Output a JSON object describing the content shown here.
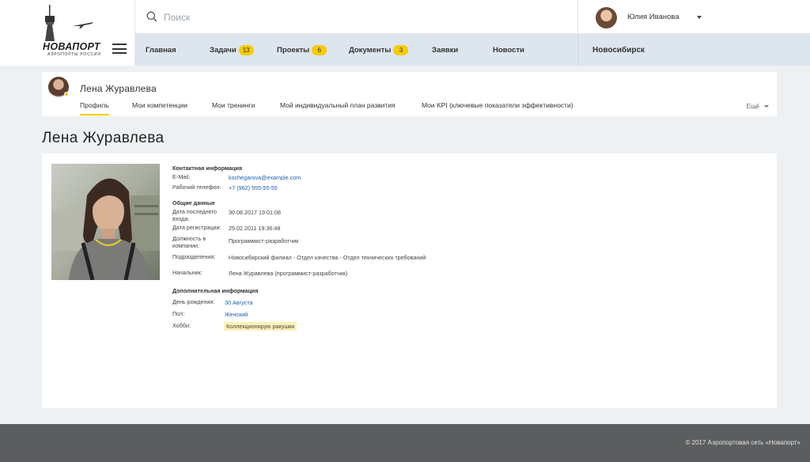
{
  "header": {
    "logo": {
      "name": "НОВАПОРТ",
      "tagline": "АЭРОПОРТЫ РОССИИ"
    },
    "search": {
      "placeholder": "Поиск",
      "value": ""
    },
    "user": {
      "name": "Юлия Иванова"
    }
  },
  "nav": {
    "items": [
      {
        "label": "Главная"
      },
      {
        "label": "Задачи",
        "badge": "13"
      },
      {
        "label": "Проекты",
        "badge": "6"
      },
      {
        "label": "Документы",
        "badge": "3"
      },
      {
        "label": "Заявки"
      },
      {
        "label": "Новости"
      }
    ],
    "city": "Новосибирск"
  },
  "profile_header": {
    "name": "Лена Журавлева",
    "tabs": [
      {
        "label": "Профиль",
        "active": true
      },
      {
        "label": "Мои компетенции"
      },
      {
        "label": "Мои тренинги"
      },
      {
        "label": "Мой индивидуальный план развития"
      },
      {
        "label": "Мои KPI (ключевые показатели эффективности)"
      }
    ],
    "more": "Ещё"
  },
  "page_title": "Лена Журавлева",
  "profile": {
    "contact": {
      "title": "Контактная информация",
      "email_label": "E-Mail:",
      "email": "kochegarova@example.com",
      "phone_label": "Рабочий телефон:",
      "phone": "+7 (962) 555-55-55"
    },
    "general": {
      "title": "Общие данные",
      "last_login_label": "Дата последнего входа:",
      "last_login": "30.08.2017 19:01:08",
      "registration_label": "Дата регистрации:",
      "registration": "25.02.2011 19:36:48",
      "position_label": "Должность в компании:",
      "position": "Программист-разработчик",
      "department_label": "Подразделения:",
      "department": "Новосибирский филиал - Отдел качества - Отдел технических требований",
      "manager_label": "Начальник:",
      "manager": "Лена Журавлева (программист-разработчик)"
    },
    "extra": {
      "title": "Дополнительная информация",
      "birthday_label": "День рождения:",
      "birthday": "30 Августа",
      "gender_label": "Пол:",
      "gender": "Женский",
      "hobby_label": "Хобби:",
      "hobby": "Коллекционирую ракушки"
    }
  },
  "footer": {
    "copyright": "© 2017 Аэропортовая сеть «Новапорт»"
  },
  "colors": {
    "accent": "#f5cc00",
    "nav_bg": "#dde5ee",
    "link": "#1f5fa8",
    "footer_bg": "#5b5d5f",
    "page_bg": "#eef1f4"
  }
}
